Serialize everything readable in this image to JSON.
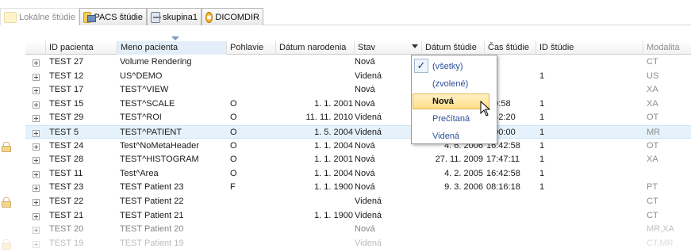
{
  "tabs": [
    {
      "label": "Lokálne štúdie",
      "icon": "folder-icon",
      "active": true
    },
    {
      "label": "PACS štúdie",
      "icon": "pacs-folder-icon",
      "active": false
    },
    {
      "label": "skupina1",
      "icon": "group-icon",
      "active": false
    },
    {
      "label": "DICOMDIR",
      "icon": "disc-icon",
      "active": false
    }
  ],
  "columns": {
    "id": "ID pacienta",
    "name": "Meno pacienta",
    "sex": "Pohlavie",
    "dob": "Dátum narodenia",
    "status": "Stav",
    "study_date": "Dátum štúdie",
    "study_time": "Čas štúdie",
    "study_id": "ID štúdie",
    "modality": "Modalita"
  },
  "rows": [
    {
      "id": "TEST 27",
      "name": "Volume Rendering",
      "sex": "",
      "dob": "",
      "status": "Nová",
      "study_date": "",
      "study_time": "",
      "study_id": "",
      "modality": "CT"
    },
    {
      "id": "TEST 12",
      "name": "US^DEMO",
      "sex": "",
      "dob": "",
      "status": "Videná",
      "study_date": "",
      "study_time": "",
      "study_id": "1",
      "modality": "US"
    },
    {
      "id": "TEST 17",
      "name": "TEST^VIEW",
      "sex": "",
      "dob": "",
      "status": "Nová",
      "study_date": "",
      "study_time": "",
      "study_id": "",
      "modality": "XA"
    },
    {
      "id": "TEST 15",
      "name": "TEST^SCALE",
      "sex": "O",
      "dob": "1. 1. 2001",
      "status": "Nová",
      "study_date": "",
      "study_time": ":20:58",
      "study_id": "1",
      "modality": "XA"
    },
    {
      "id": "TEST 29",
      "name": "TEST^ROI",
      "sex": "O",
      "dob": "11. 11. 2010",
      "status": "Videná",
      "study_date": "",
      "study_time": "2:42:20",
      "study_id": "1",
      "modality": "OT"
    },
    {
      "id": "TEST 5",
      "name": "TEST^PATIENT",
      "sex": "O",
      "dob": "1. 5. 2004",
      "status": "Videná",
      "study_date": "",
      "study_time": "2:00:00",
      "study_id": "1",
      "modality": "MR"
    },
    {
      "id": "TEST 24",
      "name": "Test^NoMetaHeader",
      "sex": "O",
      "dob": "1. 1. 2004",
      "status": "Nová",
      "study_date": "4. 6. 2006",
      "study_time": "16:42:58",
      "study_id": "1",
      "modality": "OT"
    },
    {
      "id": "TEST 28",
      "name": "TEST^HISTOGRAM",
      "sex": "O",
      "dob": "1. 1. 2001",
      "status": "Nová",
      "study_date": "27. 11. 2009",
      "study_time": "17:47:11",
      "study_id": "1",
      "modality": "XA"
    },
    {
      "id": "TEST 11",
      "name": "Test^Area",
      "sex": "O",
      "dob": "1. 1. 2004",
      "status": "Nová",
      "study_date": "4. 2. 2005",
      "study_time": "16:42:58",
      "study_id": "1",
      "modality": ""
    },
    {
      "id": "TEST 23",
      "name": "TEST Patient 23",
      "sex": "F",
      "dob": "1. 1. 1900",
      "status": "Nová",
      "study_date": "9. 3. 2006",
      "study_time": "08:16:18",
      "study_id": "1",
      "modality": "PT"
    },
    {
      "id": "TEST 22",
      "name": "TEST Patient 22",
      "sex": "",
      "dob": "",
      "status": "Videná",
      "study_date": "",
      "study_time": "",
      "study_id": "",
      "modality": "CT"
    },
    {
      "id": "TEST 21",
      "name": "TEST Patient 21",
      "sex": "",
      "dob": "1. 1. 1900",
      "status": "Videná",
      "study_date": "",
      "study_time": "",
      "study_id": "",
      "modality": "CT"
    },
    {
      "id": "TEST 20",
      "name": "TEST Patient 20",
      "sex": "",
      "dob": "",
      "status": "Nová",
      "study_date": "",
      "study_time": "",
      "study_id": "",
      "modality": "MR,XA"
    },
    {
      "id": "TEST 19",
      "name": "TEST Patient 19",
      "sex": "",
      "dob": "",
      "status": "Videná",
      "study_date": "",
      "study_time": "",
      "study_id": "",
      "modality": "CT,MR"
    }
  ],
  "status_filter": {
    "options": [
      "(všetky)",
      "(zvolené)",
      "Nová",
      "Prečítaná",
      "Videná"
    ],
    "checked": "(všetky)",
    "hovered": "Nová"
  }
}
